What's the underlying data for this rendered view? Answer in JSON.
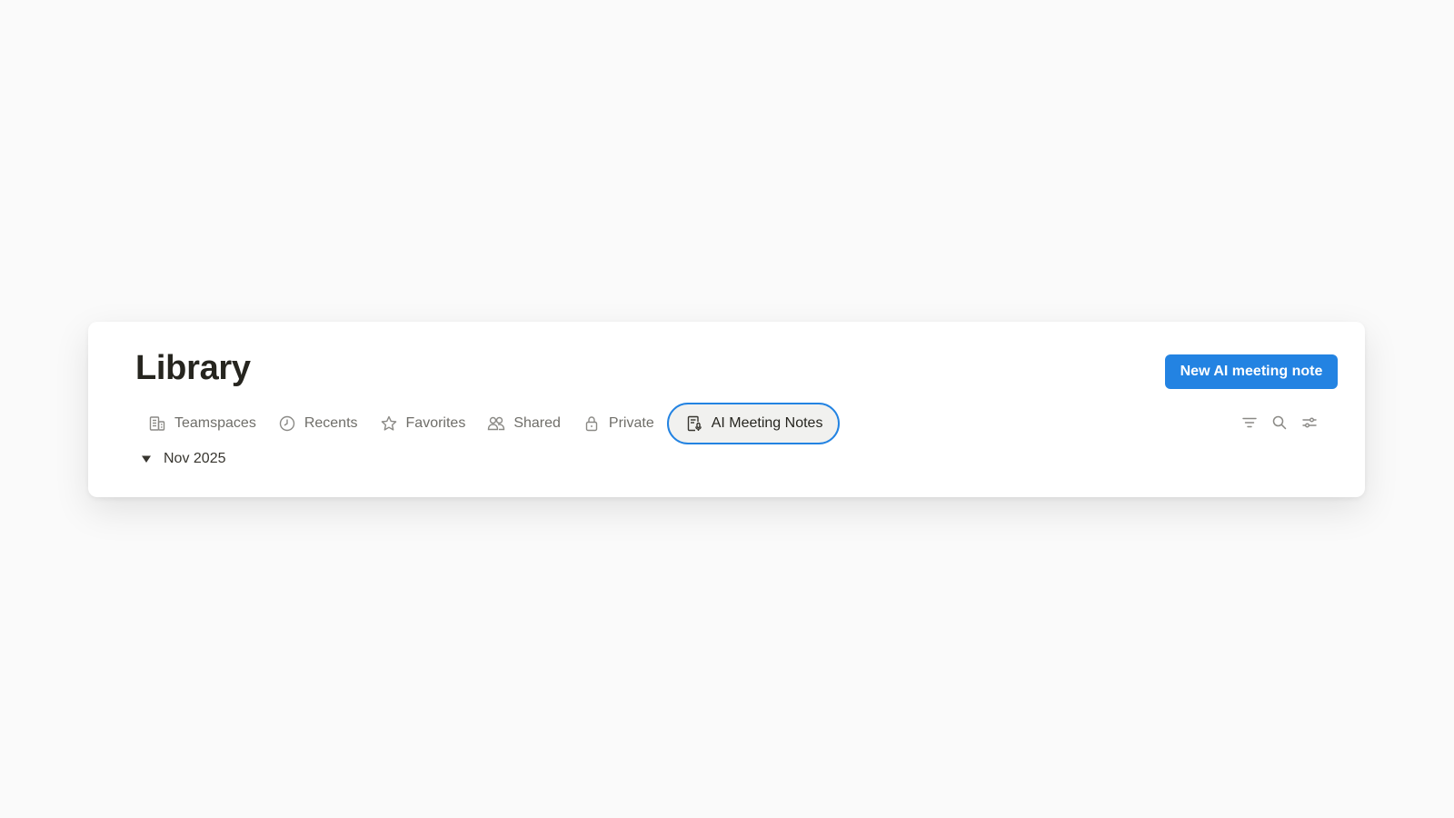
{
  "header": {
    "title": "Library",
    "new_button_label": "New AI meeting note"
  },
  "tabs": [
    {
      "label": "Teamspaces",
      "icon": "building-icon",
      "active": false
    },
    {
      "label": "Recents",
      "icon": "clock-icon",
      "active": false
    },
    {
      "label": "Favorites",
      "icon": "star-icon",
      "active": false
    },
    {
      "label": "Shared",
      "icon": "people-icon",
      "active": false
    },
    {
      "label": "Private",
      "icon": "lock-icon",
      "active": false
    },
    {
      "label": "AI Meeting Notes",
      "icon": "meeting-notes-icon",
      "active": true
    }
  ],
  "toolbar": {
    "icons": [
      "filter-icon",
      "search-icon",
      "settings-sliders-icon"
    ]
  },
  "groups": [
    {
      "label": "Nov 2025",
      "expanded": true
    }
  ],
  "colors": {
    "accent": "#2383e2",
    "background": "#fafafa",
    "card": "#ffffff",
    "text": "#37352f",
    "muted_text": "#6f6e69"
  }
}
